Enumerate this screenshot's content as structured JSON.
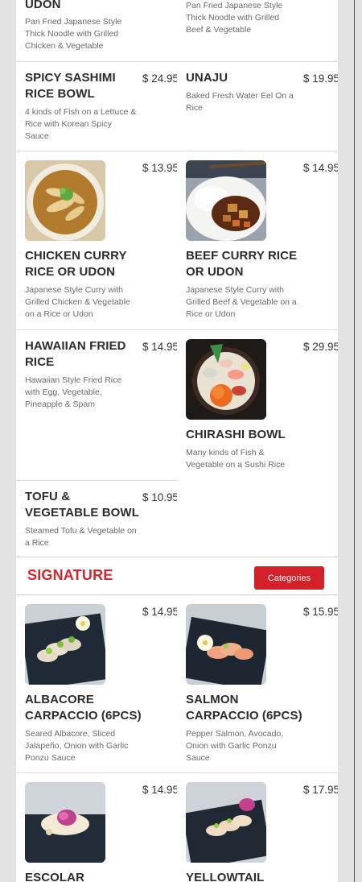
{
  "section": {
    "title": "SIGNATURE",
    "button": "Categories"
  },
  "items": [
    {
      "name": "UDON",
      "price": "",
      "desc": "Pan Fried Japanese Style Thick Noodle with Grilled Chicken & Vegetable",
      "image": null
    },
    {
      "name": "",
      "price": "",
      "desc": "Pan Fried Japanese Style Thick Noodle with Grilled Beef & Vegetable",
      "image": null
    },
    {
      "name": "SPICY SASHIMI RICE BOWL",
      "price": "$ 24.95",
      "desc": "4 kinds of Fish on a Lettuce & Rice with Korean Spicy Sauce",
      "image": null
    },
    {
      "name": "UNAJU",
      "price": "$ 19.95",
      "desc": "Baked Fresh Water Eel On a Rice",
      "image": null
    },
    {
      "name": "CHICKEN CURRY RICE OR UDON",
      "price": "$ 13.95",
      "desc": "Japanese Style Curry with Grilled Chicken & Vegetable on a Rice or Udon",
      "image": "curry-udon-photo"
    },
    {
      "name": "BEEF CURRY RICE OR UDON",
      "price": "$ 14.95",
      "desc": "Japanese Style Curry with Grilled Beef & Vegetable on a Rice or Udon",
      "image": "beef-curry-rice-photo"
    },
    {
      "name": "HAWAIIAN FRIED RICE",
      "price": "$ 14.95",
      "desc": "Hawaiian Style Fried Rice with Egg, Vegetable, Pineapple & Spam",
      "image": null
    },
    {
      "name": "CHIRASHI BOWL",
      "price": "$ 29.95",
      "desc": "Many kinds of Fish & Vegetable on a Sushi Rice",
      "image": "chirashi-bowl-photo"
    },
    {
      "name": "TOFU & VEGETABLE BOWL",
      "price": "$ 10.95",
      "desc": "Steamed Tofu & Vegetable on a Rice",
      "image": null
    },
    {
      "name": "ALBACORE CARPACCIO (6PCS)",
      "price": "$ 14.95",
      "desc": "Seared Albacore, Sliced Jalapeño, Onion with Garlic Ponzu Sauce",
      "image": "albacore-carpaccio-photo"
    },
    {
      "name": "SALMON CARPACCIO (6PCS)",
      "price": "$ 15.95",
      "desc": "Pepper Salmon, Avocado, Onion with Garlic Ponzu Sauce",
      "image": "salmon-carpaccio-photo"
    },
    {
      "name": "ESCOLAR",
      "price": "$ 14.95",
      "desc": "",
      "image": "escolar-photo"
    },
    {
      "name": "YELLOWTAIL",
      "price": "$ 17.95",
      "desc": "",
      "image": "yellowtail-photo"
    }
  ]
}
